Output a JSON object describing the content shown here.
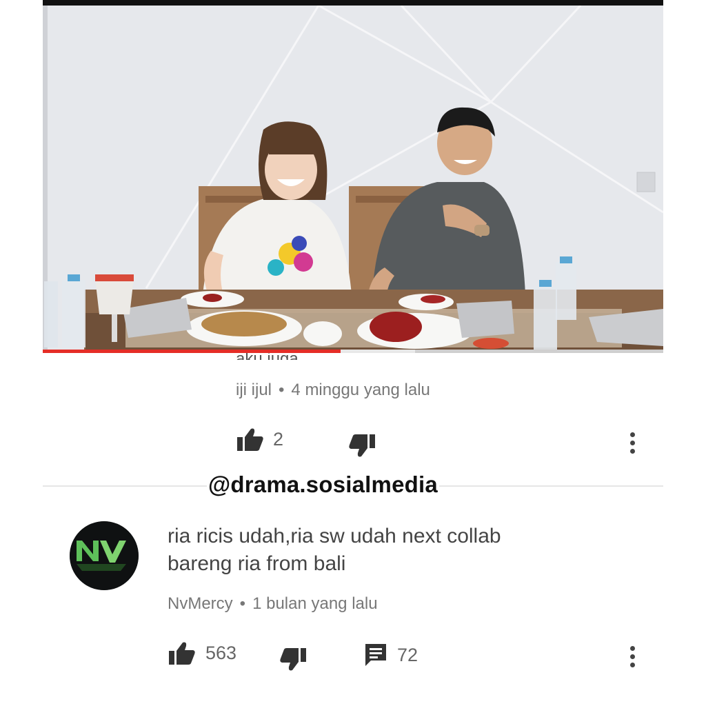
{
  "video": {
    "progress_fraction": 0.48
  },
  "prev_comment": {
    "clipped_text": "aku juga",
    "author": "iji ijul",
    "time": "4 minggu yang lalu",
    "likes": "2"
  },
  "watermark": "@drama.sosialmedia",
  "comment": {
    "avatar_text": "NV",
    "text_line1": "ria ricis udah,ria sw udah next collab",
    "text_line2": "bareng ria from bali",
    "author": "NvMercy",
    "time": "1 bulan yang lalu",
    "likes": "563",
    "replies": "72"
  },
  "icons": {
    "like": "thumb-up-icon",
    "dislike": "thumb-down-icon",
    "reply": "comment-icon",
    "more": "more-vert-icon"
  },
  "colors": {
    "progress_played": "#e52d27",
    "avatar_logo": "#5ec05a"
  }
}
